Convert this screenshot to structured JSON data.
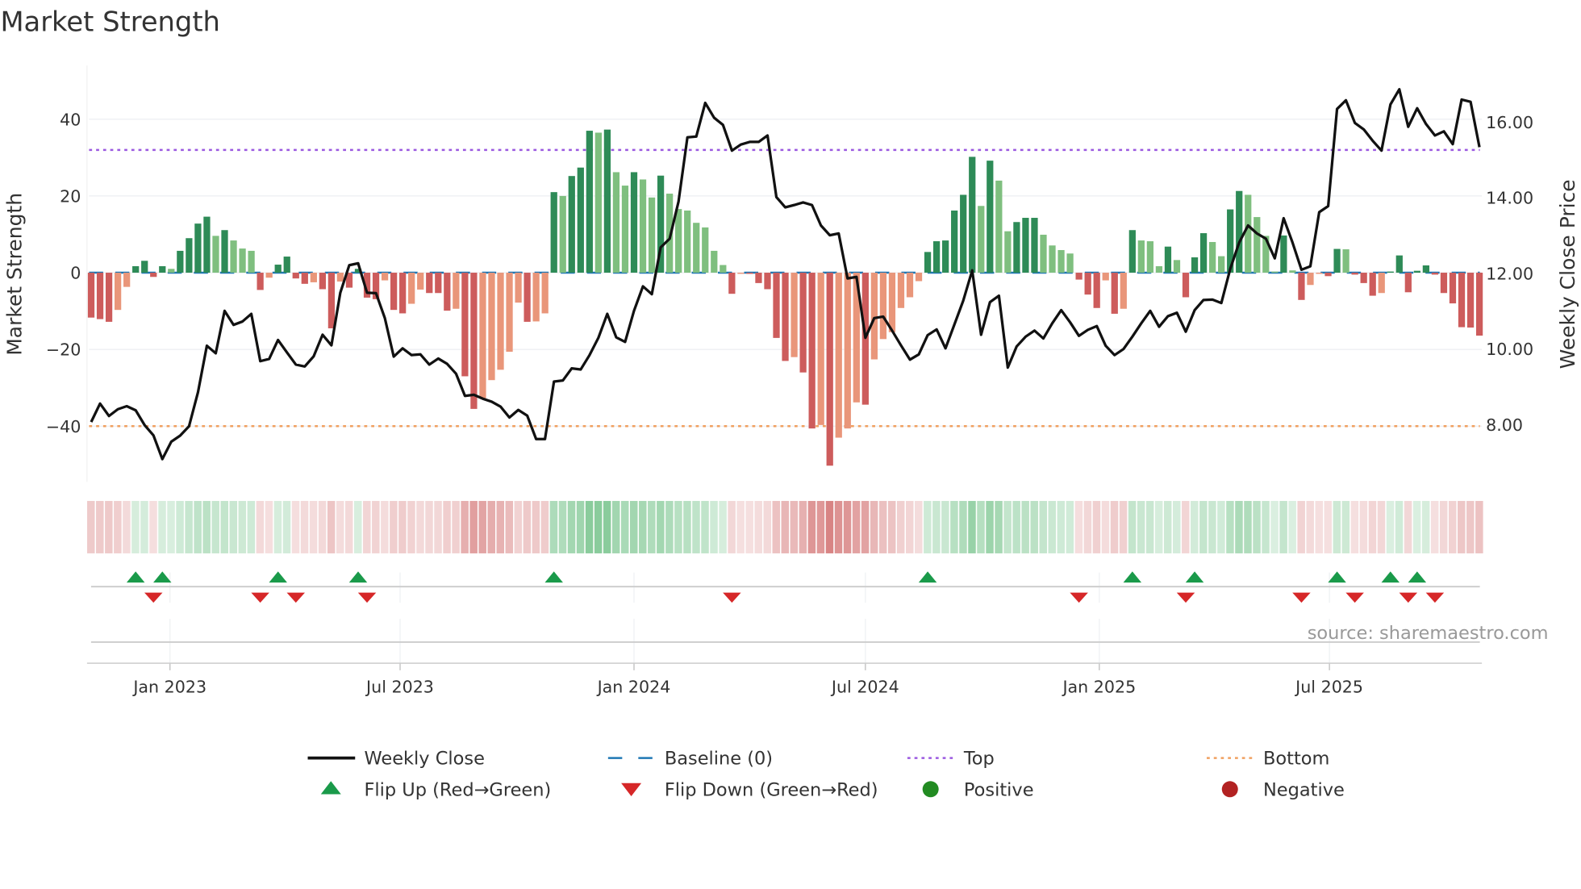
{
  "chart_data": {
    "type": "bar+line",
    "title": "Market Strength",
    "ylabel": "Market Strength",
    "y2label": "Weekly Close Price",
    "ylim": [
      -54.5,
      54
    ],
    "y2lim": [
      6.49,
      17.5
    ],
    "frequency": "weekly",
    "x_start": "2022-10-31",
    "yticks": [
      {
        "v": 40,
        "label": "40"
      },
      {
        "v": 20,
        "label": "20"
      },
      {
        "v": 0,
        "label": "0"
      },
      {
        "v": -20,
        "label": "−20"
      },
      {
        "v": -40,
        "label": "−40"
      }
    ],
    "y2ticks": [
      {
        "v": 16,
        "label": "16.00"
      },
      {
        "v": 14,
        "label": "14.00"
      },
      {
        "v": 12,
        "label": "12.00"
      },
      {
        "v": 10,
        "label": "10.00"
      },
      {
        "v": 8,
        "label": "8.00"
      }
    ],
    "xticks": [
      {
        "date": "2023-01-01",
        "label": "Jan 2023"
      },
      {
        "date": "2023-07-01",
        "label": "Jul 2023"
      },
      {
        "date": "2024-01-01",
        "label": "Jan 2024"
      },
      {
        "date": "2024-07-01",
        "label": "Jul 2024"
      },
      {
        "date": "2025-01-01",
        "label": "Jan 2025"
      },
      {
        "date": "2025-07-01",
        "label": "Jul 2025"
      }
    ],
    "top_level": 32,
    "bottom_level": -40,
    "baseline": 0,
    "market_strength": [
      -11.7,
      -12.1,
      -12.8,
      -9.7,
      -3.7,
      1.7,
      3.1,
      -1.1,
      1.7,
      1.0,
      5.7,
      9.0,
      12.8,
      14.6,
      9.6,
      11.1,
      8.4,
      6.3,
      5.7,
      -4.5,
      -1.3,
      2.1,
      4.2,
      -1.5,
      -2.9,
      -2.5,
      -4.3,
      -14.5,
      -2.3,
      -3.9,
      1.0,
      -6.5,
      -6.9,
      -2.0,
      -9.7,
      -10.6,
      -8.1,
      -4.4,
      -5.3,
      -5.3,
      -9.9,
      -9.4,
      -27,
      -35.5,
      -32.7,
      -28,
      -25.3,
      -20.6,
      -7.8,
      -12.8,
      -12.7,
      -10.6,
      21,
      20,
      25.2,
      27.4,
      37,
      36.5,
      37.3,
      26.2,
      22.7,
      26.2,
      24.3,
      19.6,
      25.3,
      20.6,
      16.6,
      16.2,
      13,
      11.8,
      5.7,
      2,
      -5.5,
      -0.3,
      -0.3,
      -2.7,
      -4.3,
      -17,
      -23,
      -22,
      -26,
      -40.6,
      -39.7,
      -50.3,
      -43,
      -40.6,
      -33.8,
      -34.4,
      -22.6,
      -17.3,
      -15.5,
      -9.2,
      -6.4,
      -2.2,
      5.4,
      8.2,
      8.4,
      16.2,
      20.3,
      30.2,
      17.4,
      29.2,
      24,
      10.8,
      13.2,
      14.3,
      14.3,
      9.9,
      7.1,
      5.9,
      5,
      -1.8,
      -5.7,
      -9.2,
      -2,
      -10.7,
      -9.4,
      11.1,
      8.4,
      8.2,
      1.7,
      6.8,
      3.3,
      -6.4,
      4,
      10.3,
      8,
      4.3,
      16.5,
      21.3,
      20.3,
      14.5,
      9.6,
      0.3,
      9.7,
      0.6,
      -7.1,
      -3.2,
      -0.3,
      -0.9,
      6.2,
      6.1,
      -0.5,
      -2.7,
      -6,
      -5.3,
      0.3,
      4.5,
      -5.1,
      0.5,
      1.9,
      -0.5,
      -5.3,
      -8,
      -14.2,
      -14.3,
      -16.4
    ],
    "weekly_close": [
      8.07,
      8.56,
      8.23,
      8.41,
      8.49,
      8.38,
      7.99,
      7.72,
      7.09,
      7.55,
      7.71,
      7.96,
      8.86,
      10.09,
      9.89,
      11.01,
      10.64,
      10.73,
      10.93,
      9.68,
      9.74,
      10.24,
      9.91,
      9.59,
      9.54,
      9.81,
      10.38,
      10.1,
      11.49,
      12.22,
      12.27,
      11.49,
      11.48,
      10.82,
      9.8,
      10.02,
      9.84,
      9.86,
      9.59,
      9.75,
      9.61,
      9.35,
      8.76,
      8.79,
      8.69,
      8.61,
      8.48,
      8.19,
      8.39,
      8.24,
      7.62,
      7.62,
      9.14,
      9.17,
      9.49,
      9.46,
      9.84,
      10.3,
      10.93,
      10.31,
      10.19,
      11.01,
      11.66,
      11.45,
      12.69,
      12.92,
      13.9,
      15.6,
      15.62,
      16.51,
      16.12,
      15.93,
      15.25,
      15.41,
      15.48,
      15.48,
      15.65,
      14.02,
      13.75,
      13.81,
      13.88,
      13.81,
      13.27,
      13.01,
      13.06,
      11.87,
      11.91,
      10.3,
      10.82,
      10.86,
      10.49,
      10.1,
      9.72,
      9.86,
      10.37,
      10.52,
      10.02,
      10.65,
      11.28,
      12.08,
      10.38,
      11.24,
      11.41,
      9.51,
      10.07,
      10.33,
      10.49,
      10.28,
      10.68,
      11.03,
      10.71,
      10.35,
      10.51,
      10.61,
      10.09,
      9.84,
      10.0,
      10.33,
      10.68,
      11.01,
      10.59,
      10.87,
      10.96,
      10.46,
      11.03,
      11.3,
      11.31,
      11.22,
      12.12,
      12.82,
      13.27,
      13.06,
      12.92,
      12.4,
      13.46,
      12.82,
      12.1,
      12.19,
      13.62,
      13.78,
      16.35,
      16.58,
      15.98,
      15.81,
      15.51,
      15.25,
      16.47,
      16.87,
      15.88,
      16.37,
      15.95,
      15.65,
      15.76,
      15.42,
      16.6,
      16.54,
      15.34
    ],
    "flip_up_weeks": [
      5,
      8,
      21,
      30,
      52,
      94,
      117,
      124,
      140,
      146,
      149
    ],
    "flip_down_weeks": [
      7,
      19,
      23,
      31,
      72,
      111,
      123,
      136,
      142,
      148,
      151
    ],
    "legend": [
      {
        "label": "Weekly Close",
        "kind": "line"
      },
      {
        "label": "Baseline (0)",
        "kind": "dash"
      },
      {
        "label": "Top",
        "kind": "dot-top"
      },
      {
        "label": "Bottom",
        "kind": "dot-bottom"
      },
      {
        "label": "Flip Up (Red→Green)",
        "kind": "tri-up"
      },
      {
        "label": "Flip Down (Green→Red)",
        "kind": "tri-down"
      },
      {
        "label": "Positive",
        "kind": "dot-pos"
      },
      {
        "label": "Negative",
        "kind": "dot-neg"
      }
    ],
    "legend_position": "bottom",
    "source": "source: sharemaestro.com",
    "colors": {
      "pos_strong": "#2e8b57",
      "pos_weak": "#7fbf7f",
      "neg_strong": "#cd5c5c",
      "neg_weak": "#e9967a",
      "line": "#111111",
      "baseline": "#1f77b4",
      "top": "#9b59e0",
      "bottom": "#f0a060",
      "flip_up": "#1a9a4a",
      "flip_down": "#d62728",
      "positive": "#228b22",
      "negative": "#b22222"
    }
  }
}
